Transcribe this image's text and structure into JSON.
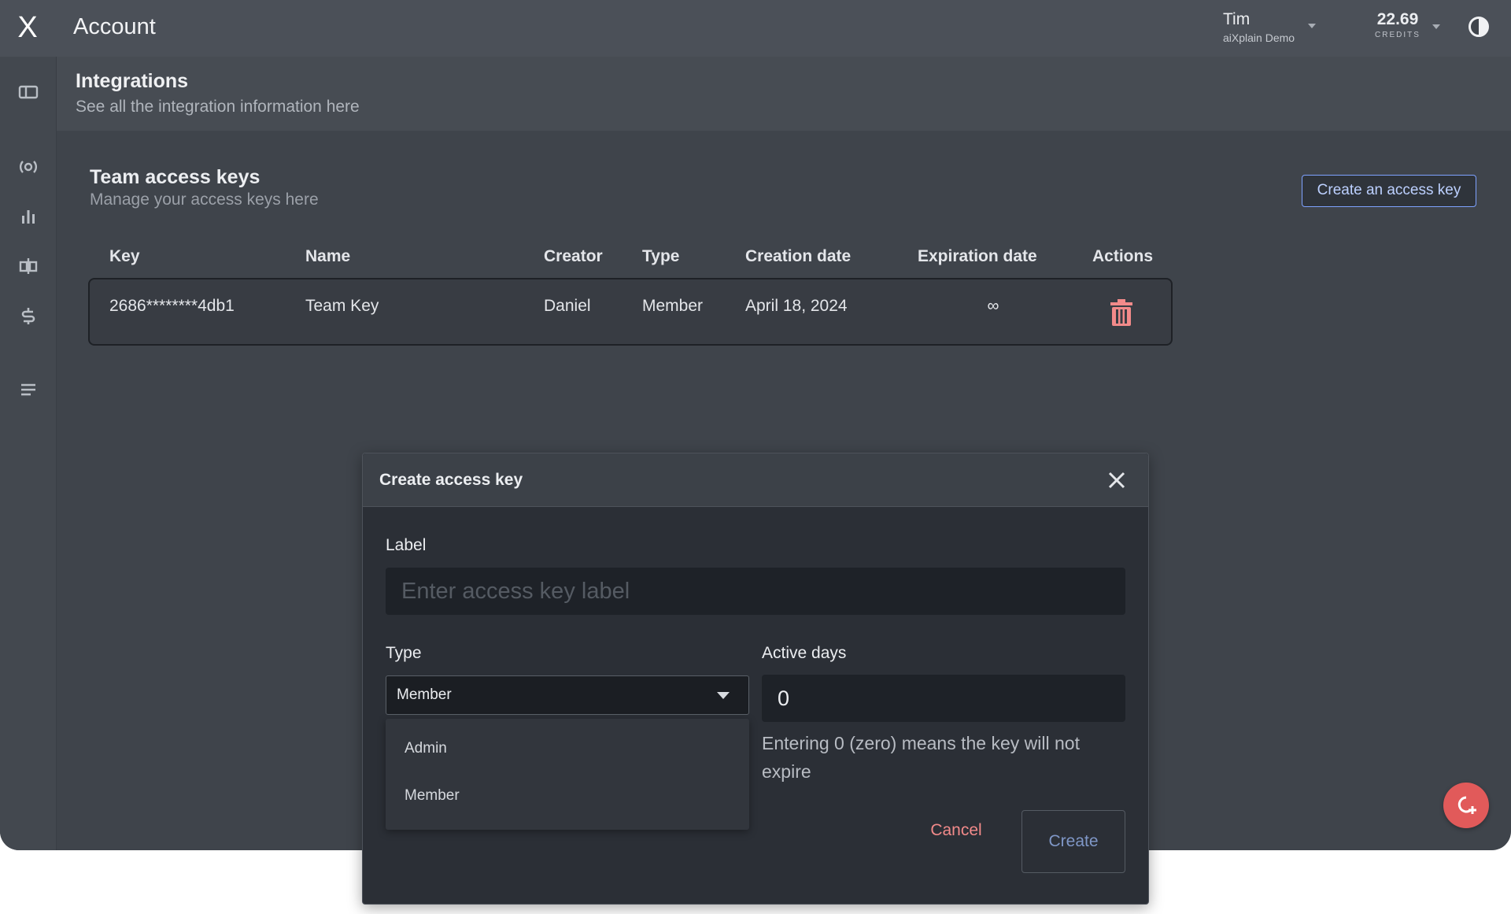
{
  "app": {
    "logo": "X",
    "title": "Account"
  },
  "user": {
    "name": "Tim",
    "org": "aiXplain Demo"
  },
  "credits": {
    "value": "22.69",
    "label": "CREDITS"
  },
  "sidebar": {
    "items": [
      {
        "icon": "dashboard-icon"
      },
      {
        "icon": "models-icon"
      },
      {
        "icon": "analytics-icon"
      },
      {
        "icon": "compare-icon"
      },
      {
        "icon": "billing-icon"
      },
      {
        "icon": "menu-icon"
      }
    ],
    "brand_colors": [
      "#f05a5a",
      "#f29a3a",
      "#f2d03a",
      "#5ac870",
      "#3ab0e0",
      "#6a7af0",
      "#a45af0",
      "#f05ab0",
      "#f05a5a",
      "#f29a3a"
    ]
  },
  "page": {
    "title": "Integrations",
    "subtitle": "See all the integration information here"
  },
  "section": {
    "title": "Team access keys",
    "subtitle": "Manage your access keys here",
    "create_button": "Create an access key"
  },
  "table": {
    "headers": {
      "key": "Key",
      "name": "Name",
      "creator": "Creator",
      "type": "Type",
      "creation_date": "Creation date",
      "expiration_date": "Expiration date",
      "actions": "Actions"
    },
    "rows": [
      {
        "key": "2686********4db1",
        "name": "Team Key",
        "creator": "Daniel",
        "type": "Member",
        "creation_date": "April 18, 2024",
        "expiration_date": "∞",
        "action_icon": "trash-icon"
      }
    ]
  },
  "modal": {
    "title": "Create access key",
    "label_field": {
      "label": "Label",
      "placeholder": "Enter access key label",
      "value": ""
    },
    "type_field": {
      "label": "Type",
      "selected": "Member",
      "options": [
        "Admin",
        "Member"
      ]
    },
    "days_field": {
      "label": "Active days",
      "value": "0",
      "hint": "Entering 0 (zero) means the key will not expire"
    },
    "cancel_label": "Cancel",
    "create_label": "Create"
  },
  "colors": {
    "accent": "#7ea2ff",
    "danger": "#f28a8a",
    "fab": "#e15a5a"
  }
}
